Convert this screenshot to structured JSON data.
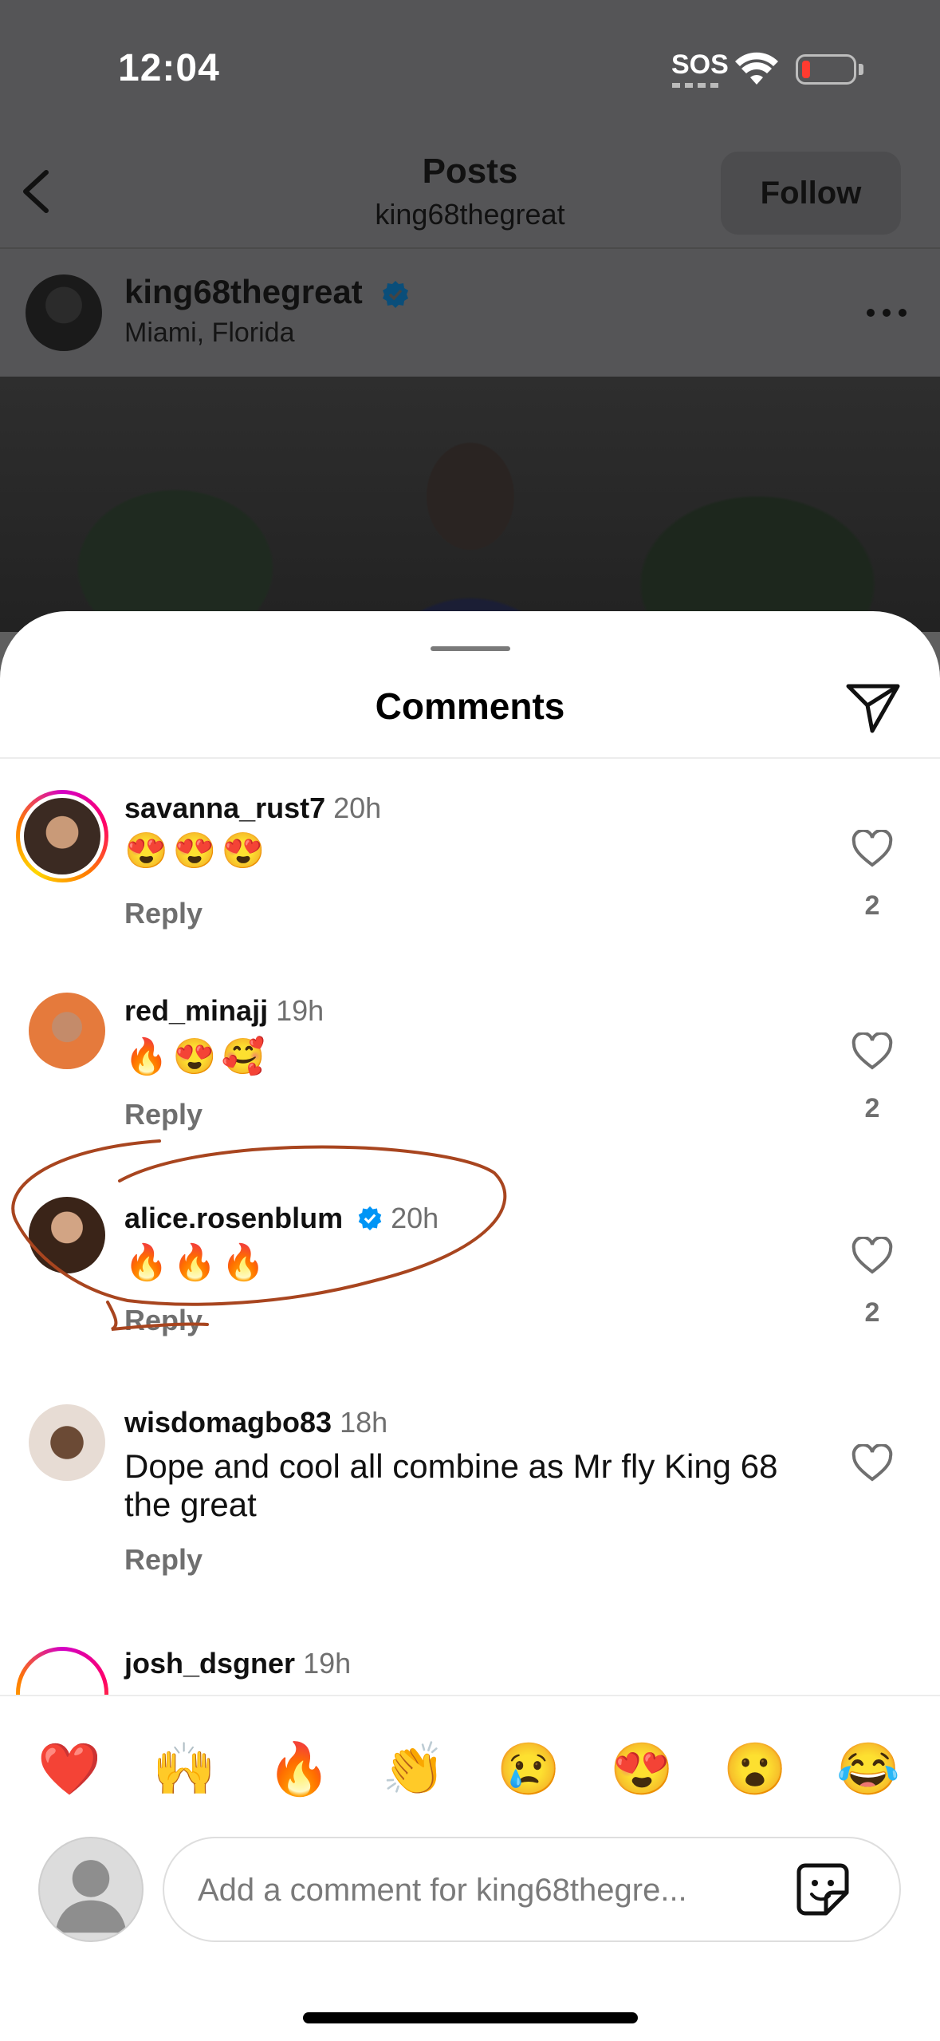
{
  "status_bar": {
    "time": "12:04",
    "sos": "SOS"
  },
  "nav": {
    "title": "Posts",
    "subtitle": "king68thegreat",
    "follow_label": "Follow"
  },
  "post": {
    "username": "king68thegreat",
    "location": "Miami, Florida",
    "verified": true
  },
  "sheet": {
    "title": "Comments"
  },
  "comments": [
    {
      "username": "savanna_rust7",
      "time": "20h",
      "text": "😍😍😍",
      "reply": "Reply",
      "likes": "2",
      "story_ring": true
    },
    {
      "username": "red_minajj",
      "time": "19h",
      "text": "🔥😍🥰",
      "reply": "Reply",
      "likes": "2",
      "story_ring": false
    },
    {
      "username": "alice.rosenblum",
      "time": "20h",
      "text": "🔥🔥🔥",
      "reply": "Reply",
      "likes": "2",
      "verified": true,
      "story_ring": false
    },
    {
      "username": "wisdomagbo83",
      "time": "18h",
      "text": "Dope and cool all combine as Mr fly King 68 the great",
      "reply": "Reply",
      "likes": "",
      "story_ring": false
    },
    {
      "username": "josh_dsgner",
      "time": "19h",
      "text": "",
      "reply": "",
      "likes": "",
      "story_ring": true
    }
  ],
  "quick_emojis": [
    "❤️",
    "🙌",
    "🔥",
    "👏",
    "😢",
    "😍",
    "😮",
    "😂"
  ],
  "composer": {
    "placeholder": "Add a comment for king68thegre..."
  },
  "colors": {
    "verified": "#0095f6",
    "annotation": "#a8451f",
    "muted": "#6f6f6f"
  },
  "icons": [
    "back-icon",
    "wifi-icon",
    "battery-icon",
    "verified-icon",
    "more-icon",
    "share-icon",
    "heart-icon",
    "sticker-icon",
    "avatar-placeholder-icon"
  ]
}
